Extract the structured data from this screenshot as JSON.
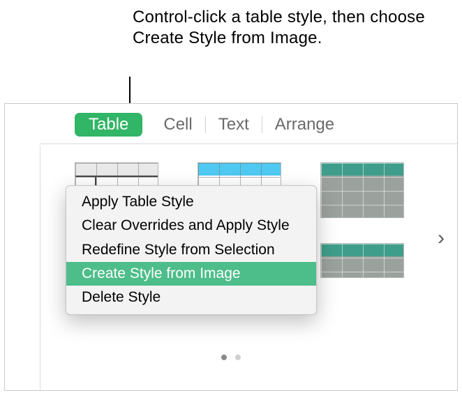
{
  "callout": "Control-click a table style, then choose Create Style from Image.",
  "tabs": {
    "table": "Table",
    "cell": "Cell",
    "text": "Text",
    "arrange": "Arrange"
  },
  "menu": {
    "apply": "Apply Table Style",
    "clear": "Clear Overrides and Apply Style",
    "redefine": "Redefine Style from Selection",
    "create": "Create Style from Image",
    "delete": "Delete Style"
  },
  "icons": {
    "chevron_right": "›"
  }
}
